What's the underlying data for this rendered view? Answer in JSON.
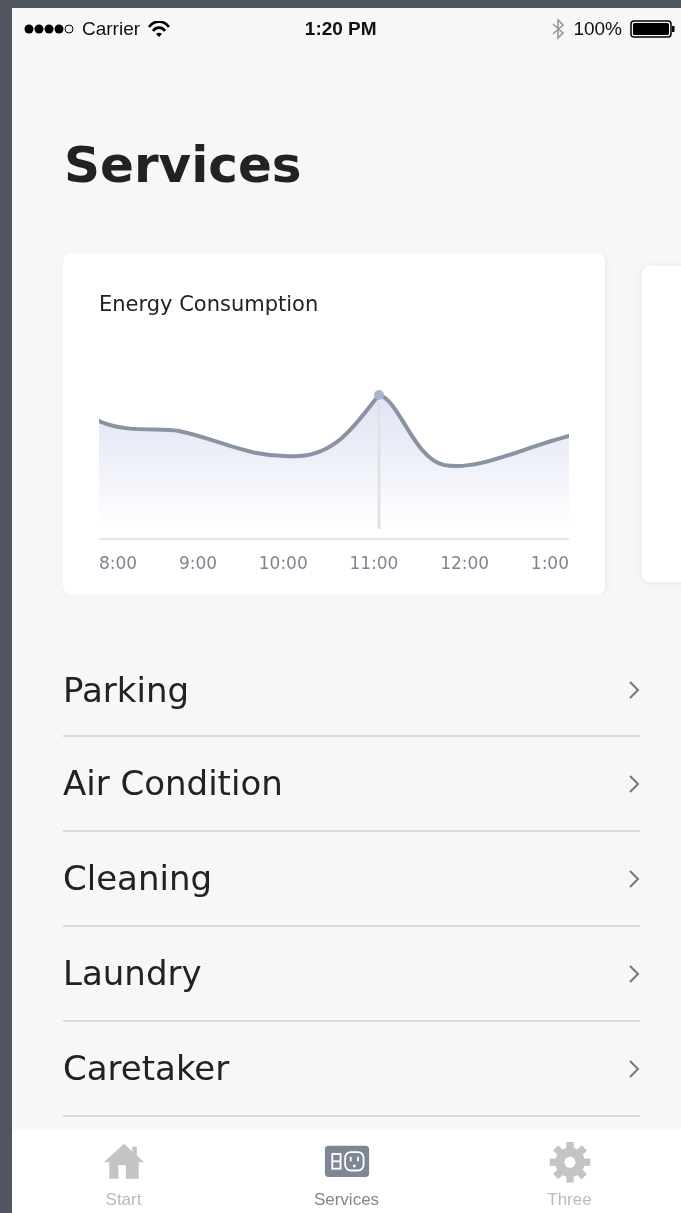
{
  "status_bar": {
    "carrier": "Carrier",
    "time": "1:20 PM",
    "battery": "100%"
  },
  "title": "Services",
  "chart_card": {
    "title": "Energy Consumption",
    "x_labels": [
      "8:00",
      "9:00",
      "10:00",
      "11:00",
      "12:00",
      "1:00"
    ]
  },
  "services": [
    {
      "label": "Parking"
    },
    {
      "label": "Air Condition"
    },
    {
      "label": "Cleaning"
    },
    {
      "label": "Laundry"
    },
    {
      "label": "Caretaker"
    }
  ],
  "tabs": [
    {
      "label": "Start",
      "kind": "home",
      "selected": false
    },
    {
      "label": "Services",
      "kind": "outlet",
      "selected": true
    },
    {
      "label": "Three",
      "kind": "gear",
      "selected": false
    }
  ]
}
